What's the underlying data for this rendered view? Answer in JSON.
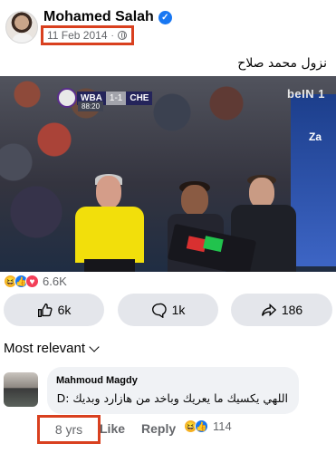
{
  "post": {
    "author": "Mohamed Salah",
    "verified_icon": "verified-badge-icon",
    "date": "11 Feb 2014",
    "separator": "·",
    "audience_icon": "globe-icon",
    "caption": "نزول محمد صلاح"
  },
  "photo": {
    "scoreboard": {
      "home": "WBA",
      "score": "1-1",
      "away": "CHE",
      "clock": "88:20"
    },
    "broadcaster": "beIN 1",
    "board_text": "Za"
  },
  "reactions": {
    "icons": [
      "haha-icon",
      "like-icon",
      "love-icon"
    ],
    "count": "6.6K"
  },
  "actions": {
    "like_count": "6k",
    "comment_count": "1k",
    "share_count": "186"
  },
  "comments_sort": {
    "label": "Most relevant"
  },
  "comment": {
    "author": "Mahmoud Magdy",
    "text": "اللهي يكسيك ما يعريك وباخد من هازارد وبديك :D",
    "time": "8 yrs",
    "like_label": "Like",
    "reply_label": "Reply",
    "reaction_count": "114"
  },
  "colors": {
    "accent": "#1877f2",
    "highlight_box": "#d9401f",
    "button_bg": "#e4e6eb",
    "bubble_bg": "#f0f2f5",
    "muted_text": "#65676b"
  }
}
